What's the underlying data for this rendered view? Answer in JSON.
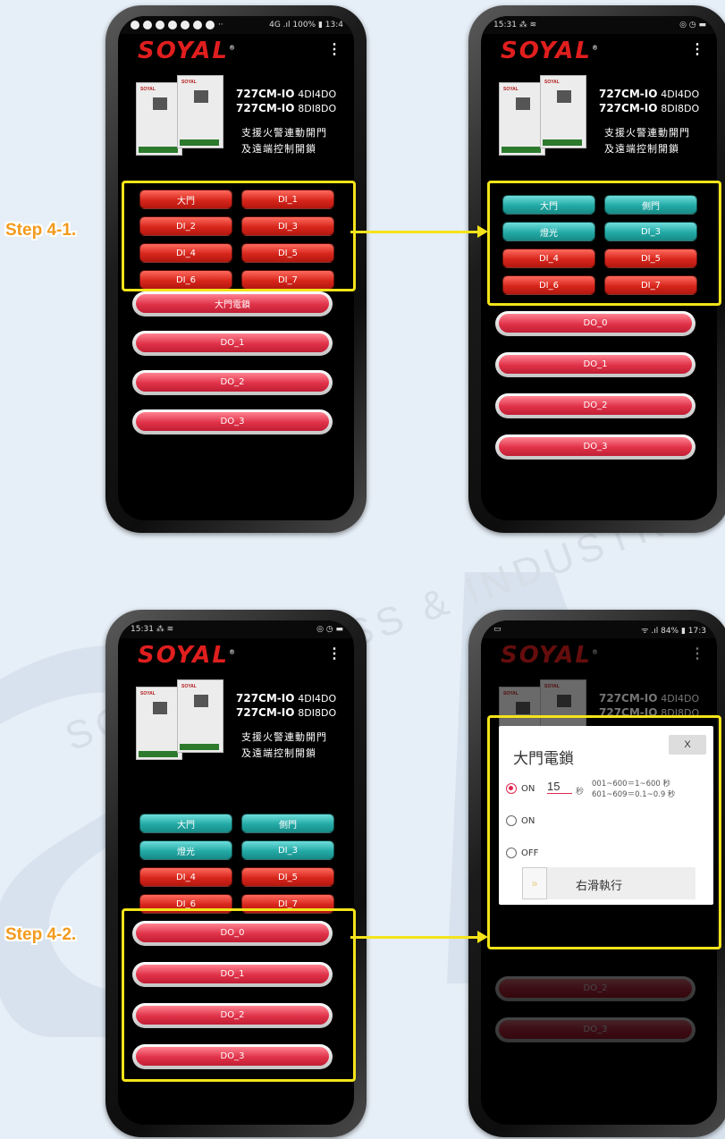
{
  "brand": {
    "name": "SOYAL",
    "reg": "®"
  },
  "menu_glyph": "⋮",
  "product": {
    "device_label": "SOYAL",
    "model1_bold": "727CM-IO",
    "model1_thin": "4DI4DO",
    "model2_bold": "727CM-IO",
    "model2_thin": "8DI8DO",
    "cn_line1": "支援火警連動開門",
    "cn_line2": "及遠端控制開鎖"
  },
  "status": {
    "p1_right": "4G .ıl 100% ▮ 13:4",
    "p1_mid": "··",
    "p2_left": "15:31 ⁂ ≋",
    "p2_right": "◎ ◷ ▬",
    "p4_right": "ᯤ .ıl 84% ▮ 17:3"
  },
  "di_default": [
    "大門",
    "DI_1",
    "DI_2",
    "DI_3",
    "DI_4",
    "DI_5",
    "DI_6",
    "DI_7"
  ],
  "di_renamed": [
    "大門",
    "側門",
    "燈光",
    "DI_3",
    "DI_4",
    "DI_5",
    "DI_6",
    "DI_7"
  ],
  "di_renamed_colors": [
    "teal",
    "teal",
    "teal",
    "teal",
    "red",
    "red",
    "red",
    "red"
  ],
  "do_default": [
    "大門電鎖",
    "DO_1",
    "DO_2",
    "DO_3"
  ],
  "do_renamed": [
    "DO_0",
    "DO_1",
    "DO_2",
    "DO_3"
  ],
  "steps": {
    "s41": "Step 4-1.",
    "s42": "Step 4-2."
  },
  "dialog": {
    "title": "大門電鎖",
    "close": "X",
    "opt1_label": "ON",
    "opt1_value": "15",
    "opt1_unit": "秒",
    "opt1_selected": true,
    "range1": "001~600＝1~600 秒",
    "range2": "601~609＝0.1~0.9 秒",
    "opt2_label": "ON",
    "opt3_label": "OFF",
    "swipe_label": "右滑執行",
    "swipe_glyph": "»"
  },
  "watermark": "SOYAL  ACCESS & INDUSTRIAL",
  "colors": {
    "highlight": "#f4e31a",
    "step_text": "#f39a1c",
    "brand_red": "#e01e1e",
    "teal": "#23aaa6",
    "red_btn": "#d7261c"
  }
}
